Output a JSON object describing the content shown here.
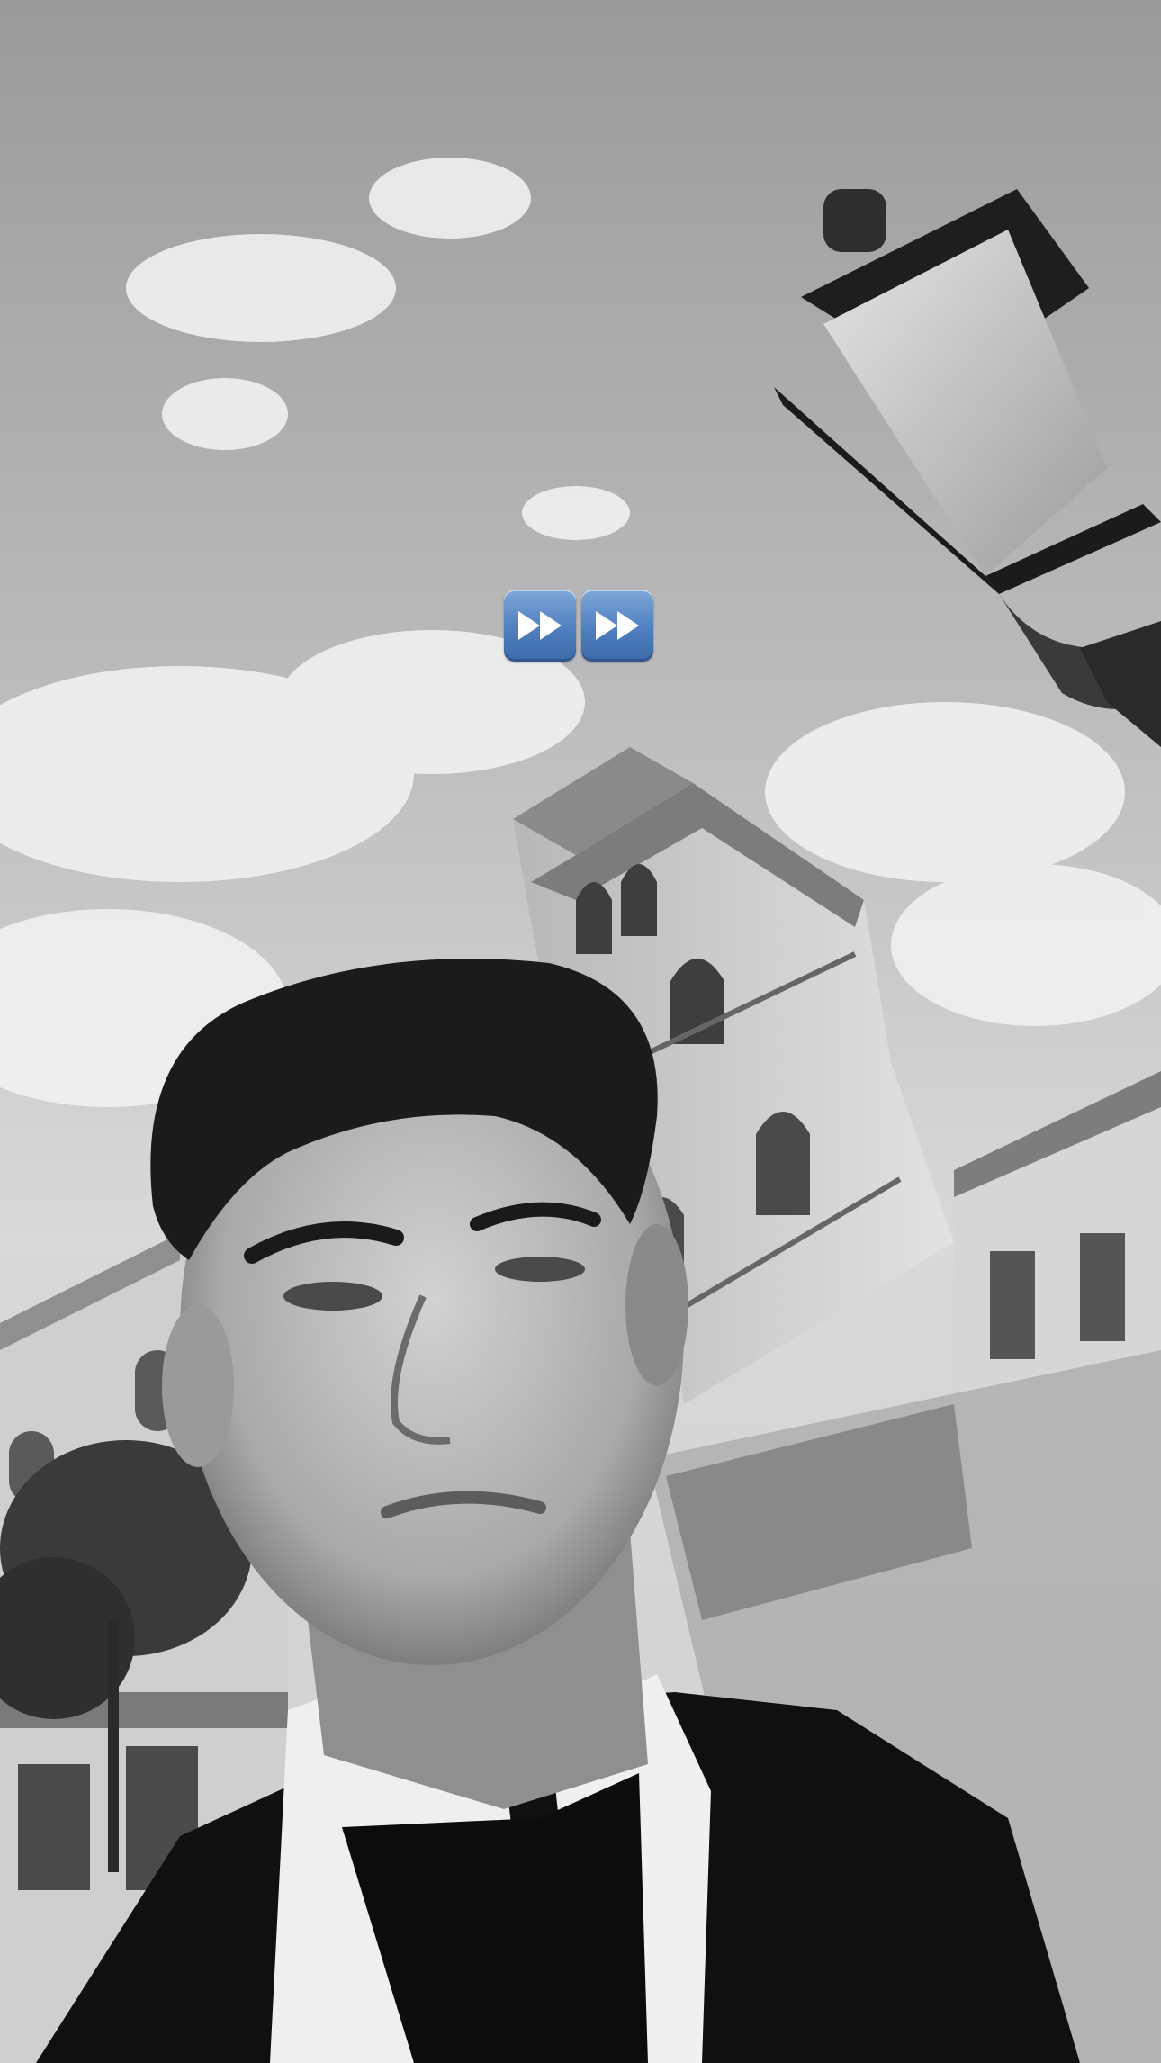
{
  "story": {
    "photo": {
      "description_icon": "photo-icon",
      "filter": "black-and-white"
    },
    "sticker": {
      "icons": [
        "fast-forward-icon",
        "fast-forward-icon"
      ],
      "accent_color": "#5a86c4"
    }
  }
}
